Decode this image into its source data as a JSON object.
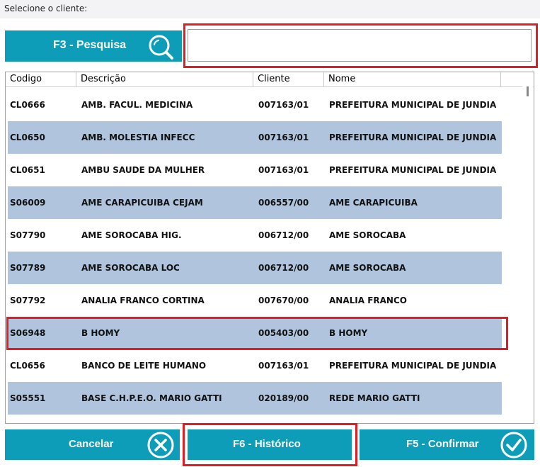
{
  "header": {
    "prompt": "Selecione o cliente:"
  },
  "search": {
    "button_label": "F3 - Pesquisa",
    "value": "",
    "placeholder": ""
  },
  "table": {
    "columns": [
      "Codigo",
      "Descrição",
      "Cliente",
      "Nome"
    ],
    "rows": [
      {
        "codigo": "CL0666",
        "descricao": "AMB. FACUL. MEDICINA",
        "cliente": "007163/01",
        "nome": "PREFEITURA MUNICIPAL DE JUNDIA"
      },
      {
        "codigo": "CL0650",
        "descricao": "AMB. MOLESTIA INFECC",
        "cliente": "007163/01",
        "nome": "PREFEITURA MUNICIPAL DE JUNDIA"
      },
      {
        "codigo": "CL0651",
        "descricao": "AMBU SAUDE DA MULHER",
        "cliente": "007163/01",
        "nome": "PREFEITURA MUNICIPAL DE JUNDIA"
      },
      {
        "codigo": "S06009",
        "descricao": "AME CARAPICUIBA CEJAM",
        "cliente": "006557/00",
        "nome": "AME CARAPICUIBA"
      },
      {
        "codigo": "S07790",
        "descricao": "AME SOROCABA HIG.",
        "cliente": "006712/00",
        "nome": "AME SOROCABA"
      },
      {
        "codigo": "S07789",
        "descricao": "AME SOROCABA LOC",
        "cliente": "006712/00",
        "nome": "AME SOROCABA"
      },
      {
        "codigo": "S07792",
        "descricao": "ANALIA FRANCO CORTINA",
        "cliente": "007670/00",
        "nome": "ANALIA FRANCO"
      },
      {
        "codigo": "S06948",
        "descricao": "B HOMY",
        "cliente": "005403/00",
        "nome": "B HOMY"
      },
      {
        "codigo": "CL0656",
        "descricao": "BANCO DE LEITE HUMANO",
        "cliente": "007163/01",
        "nome": "PREFEITURA MUNICIPAL DE JUNDIA"
      },
      {
        "codigo": "S05551",
        "descricao": "BASE C.H.P.E.O. MARIO GATTI",
        "cliente": "020189/00",
        "nome": "REDE MARIO GATTI"
      }
    ]
  },
  "buttons": {
    "cancel": "Cancelar",
    "history": "F6 - Histórico",
    "confirm": "F5 - Confirmar"
  },
  "colors": {
    "accent": "#0e9db8",
    "row_alt": "#b0c4de",
    "highlight": "#e01c24"
  },
  "icons": {
    "search": "search-icon",
    "cancel": "close-circle-icon",
    "confirm": "check-circle-icon"
  }
}
